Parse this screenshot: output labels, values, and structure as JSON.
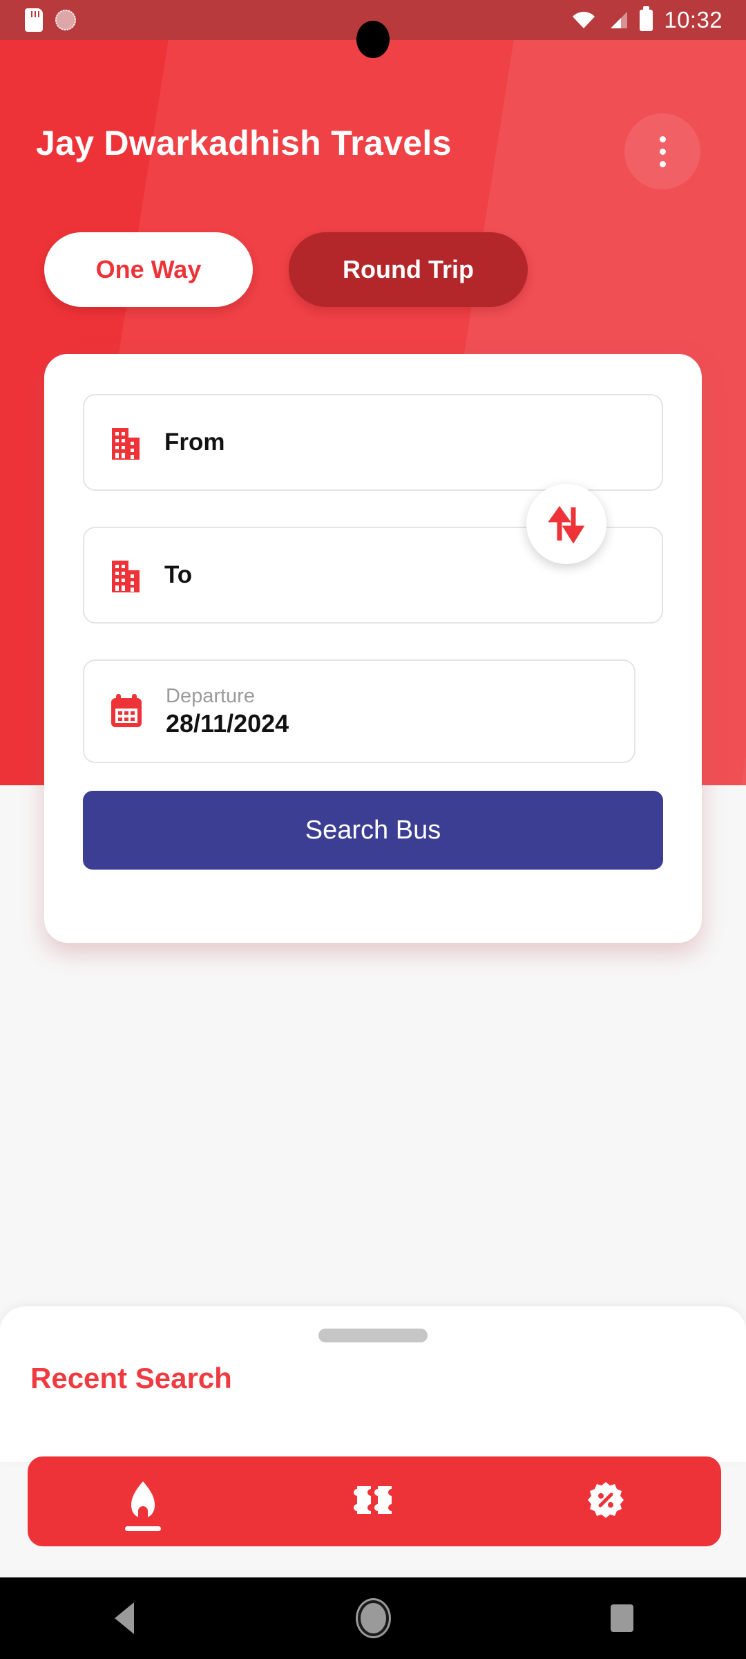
{
  "status_bar": {
    "time": "10:32",
    "left_icons": [
      "sd-card-icon",
      "brightness-icon"
    ],
    "right_icons": [
      "wifi-icon",
      "cellular-signal-icon",
      "battery-icon"
    ],
    "background_color": "#b83a3d"
  },
  "header": {
    "title": "Jay Dwarkadhish Travels",
    "background_color": "#ee3338",
    "overflow_menu_icon": "more-vertical-icon"
  },
  "trip_tabs": [
    {
      "label": "One Way",
      "active": true,
      "text_color": "#ee3338",
      "bg_color": "#ffffff"
    },
    {
      "label": "Round Trip",
      "active": false,
      "text_color": "#ffffff",
      "bg_color": "#b32629"
    }
  ],
  "search_form": {
    "from": {
      "label": "From",
      "value": "",
      "icon": "building-icon"
    },
    "to": {
      "label": "To",
      "value": "",
      "icon": "building-icon"
    },
    "swap": {
      "icon": "swap-vertical-icon"
    },
    "departure": {
      "caption": "Departure",
      "value": "28/11/2024",
      "icon": "calendar-icon"
    },
    "submit": {
      "label": "Search Bus",
      "color": "#3c3e94"
    }
  },
  "recent_search": {
    "title": "Recent Search",
    "title_color": "#ef3b40",
    "handle": "drag-handle"
  },
  "bottom_nav": {
    "background_color": "#ee3338",
    "items": [
      {
        "name": "home",
        "icon": "home-icon",
        "active": true
      },
      {
        "name": "ticket",
        "icon": "ticket-icon",
        "active": false
      },
      {
        "name": "offers",
        "icon": "offer-badge-icon",
        "active": false
      }
    ]
  },
  "android_nav": {
    "items": [
      {
        "name": "back",
        "icon": "back-triangle-icon"
      },
      {
        "name": "home",
        "icon": "home-circle-icon"
      },
      {
        "name": "recents",
        "icon": "recents-square-icon"
      }
    ]
  }
}
